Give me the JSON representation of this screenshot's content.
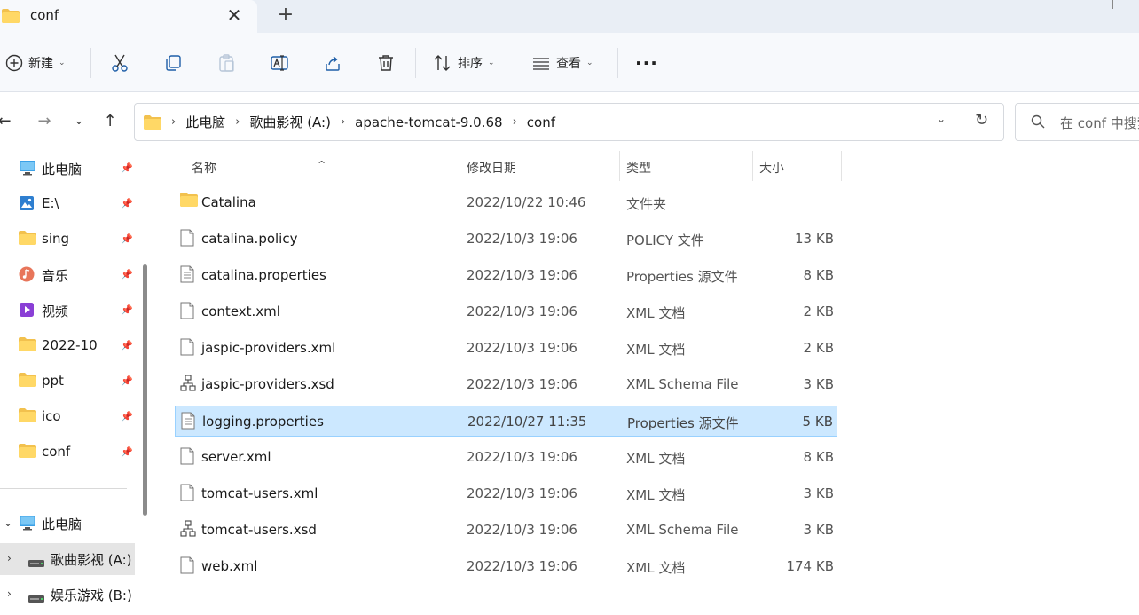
{
  "tab": {
    "title": "conf",
    "close_glyph": "✕",
    "new_tab_glyph": "+"
  },
  "toolbar": {
    "new_label": "新建",
    "sort_label": "排序",
    "view_label": "查看",
    "more_glyph": "···"
  },
  "address": {
    "crumbs": [
      "此电脑",
      "歌曲影视 (A:)",
      "apache-tomcat-9.0.68",
      "conf"
    ],
    "search_placeholder": "在 conf 中搜索"
  },
  "sidebar": {
    "quick_access": [
      {
        "label": "此电脑",
        "icon": "monitor-icon"
      },
      {
        "label": "E:\\",
        "icon": "image-icon"
      },
      {
        "label": "sing",
        "icon": "folder-icon"
      },
      {
        "label": "音乐",
        "icon": "music-icon"
      },
      {
        "label": "视频",
        "icon": "video-icon"
      },
      {
        "label": "2022-10",
        "icon": "folder-icon"
      },
      {
        "label": "ppt",
        "icon": "folder-icon"
      },
      {
        "label": "ico",
        "icon": "folder-icon"
      },
      {
        "label": "conf",
        "icon": "folder-icon"
      }
    ],
    "this_pc": "此电脑",
    "drives": [
      "歌曲影视 (A:)",
      "娱乐游戏 (B:)"
    ]
  },
  "columns": {
    "name": "名称",
    "date": "修改日期",
    "type": "类型",
    "size": "大小"
  },
  "files": [
    {
      "name": "Catalina",
      "date": "2022/10/22 10:46",
      "type": "文件夹",
      "size": "",
      "icon": "folder-icon"
    },
    {
      "name": "catalina.policy",
      "date": "2022/10/3 19:06",
      "type": "POLICY 文件",
      "size": "13 KB",
      "icon": "file-icon"
    },
    {
      "name": "catalina.properties",
      "date": "2022/10/3 19:06",
      "type": "Properties 源文件",
      "size": "8 KB",
      "icon": "text-file-icon"
    },
    {
      "name": "context.xml",
      "date": "2022/10/3 19:06",
      "type": "XML 文档",
      "size": "2 KB",
      "icon": "file-icon"
    },
    {
      "name": "jaspic-providers.xml",
      "date": "2022/10/3 19:06",
      "type": "XML 文档",
      "size": "2 KB",
      "icon": "file-icon"
    },
    {
      "name": "jaspic-providers.xsd",
      "date": "2022/10/3 19:06",
      "type": "XML Schema File",
      "size": "3 KB",
      "icon": "schema-file-icon"
    },
    {
      "name": "logging.properties",
      "date": "2022/10/27 11:35",
      "type": "Properties 源文件",
      "size": "5 KB",
      "icon": "text-file-icon",
      "selected": true
    },
    {
      "name": "server.xml",
      "date": "2022/10/3 19:06",
      "type": "XML 文档",
      "size": "8 KB",
      "icon": "file-icon"
    },
    {
      "name": "tomcat-users.xml",
      "date": "2022/10/3 19:06",
      "type": "XML 文档",
      "size": "3 KB",
      "icon": "file-icon"
    },
    {
      "name": "tomcat-users.xsd",
      "date": "2022/10/3 19:06",
      "type": "XML Schema File",
      "size": "3 KB",
      "icon": "schema-file-icon"
    },
    {
      "name": "web.xml",
      "date": "2022/10/3 19:06",
      "type": "XML 文档",
      "size": "174 KB",
      "icon": "file-icon"
    }
  ],
  "colors": {
    "folder": "#f2c14e",
    "selection": "#cce8ff",
    "selection_border": "#99d1ff",
    "accent": "#0067c0"
  }
}
